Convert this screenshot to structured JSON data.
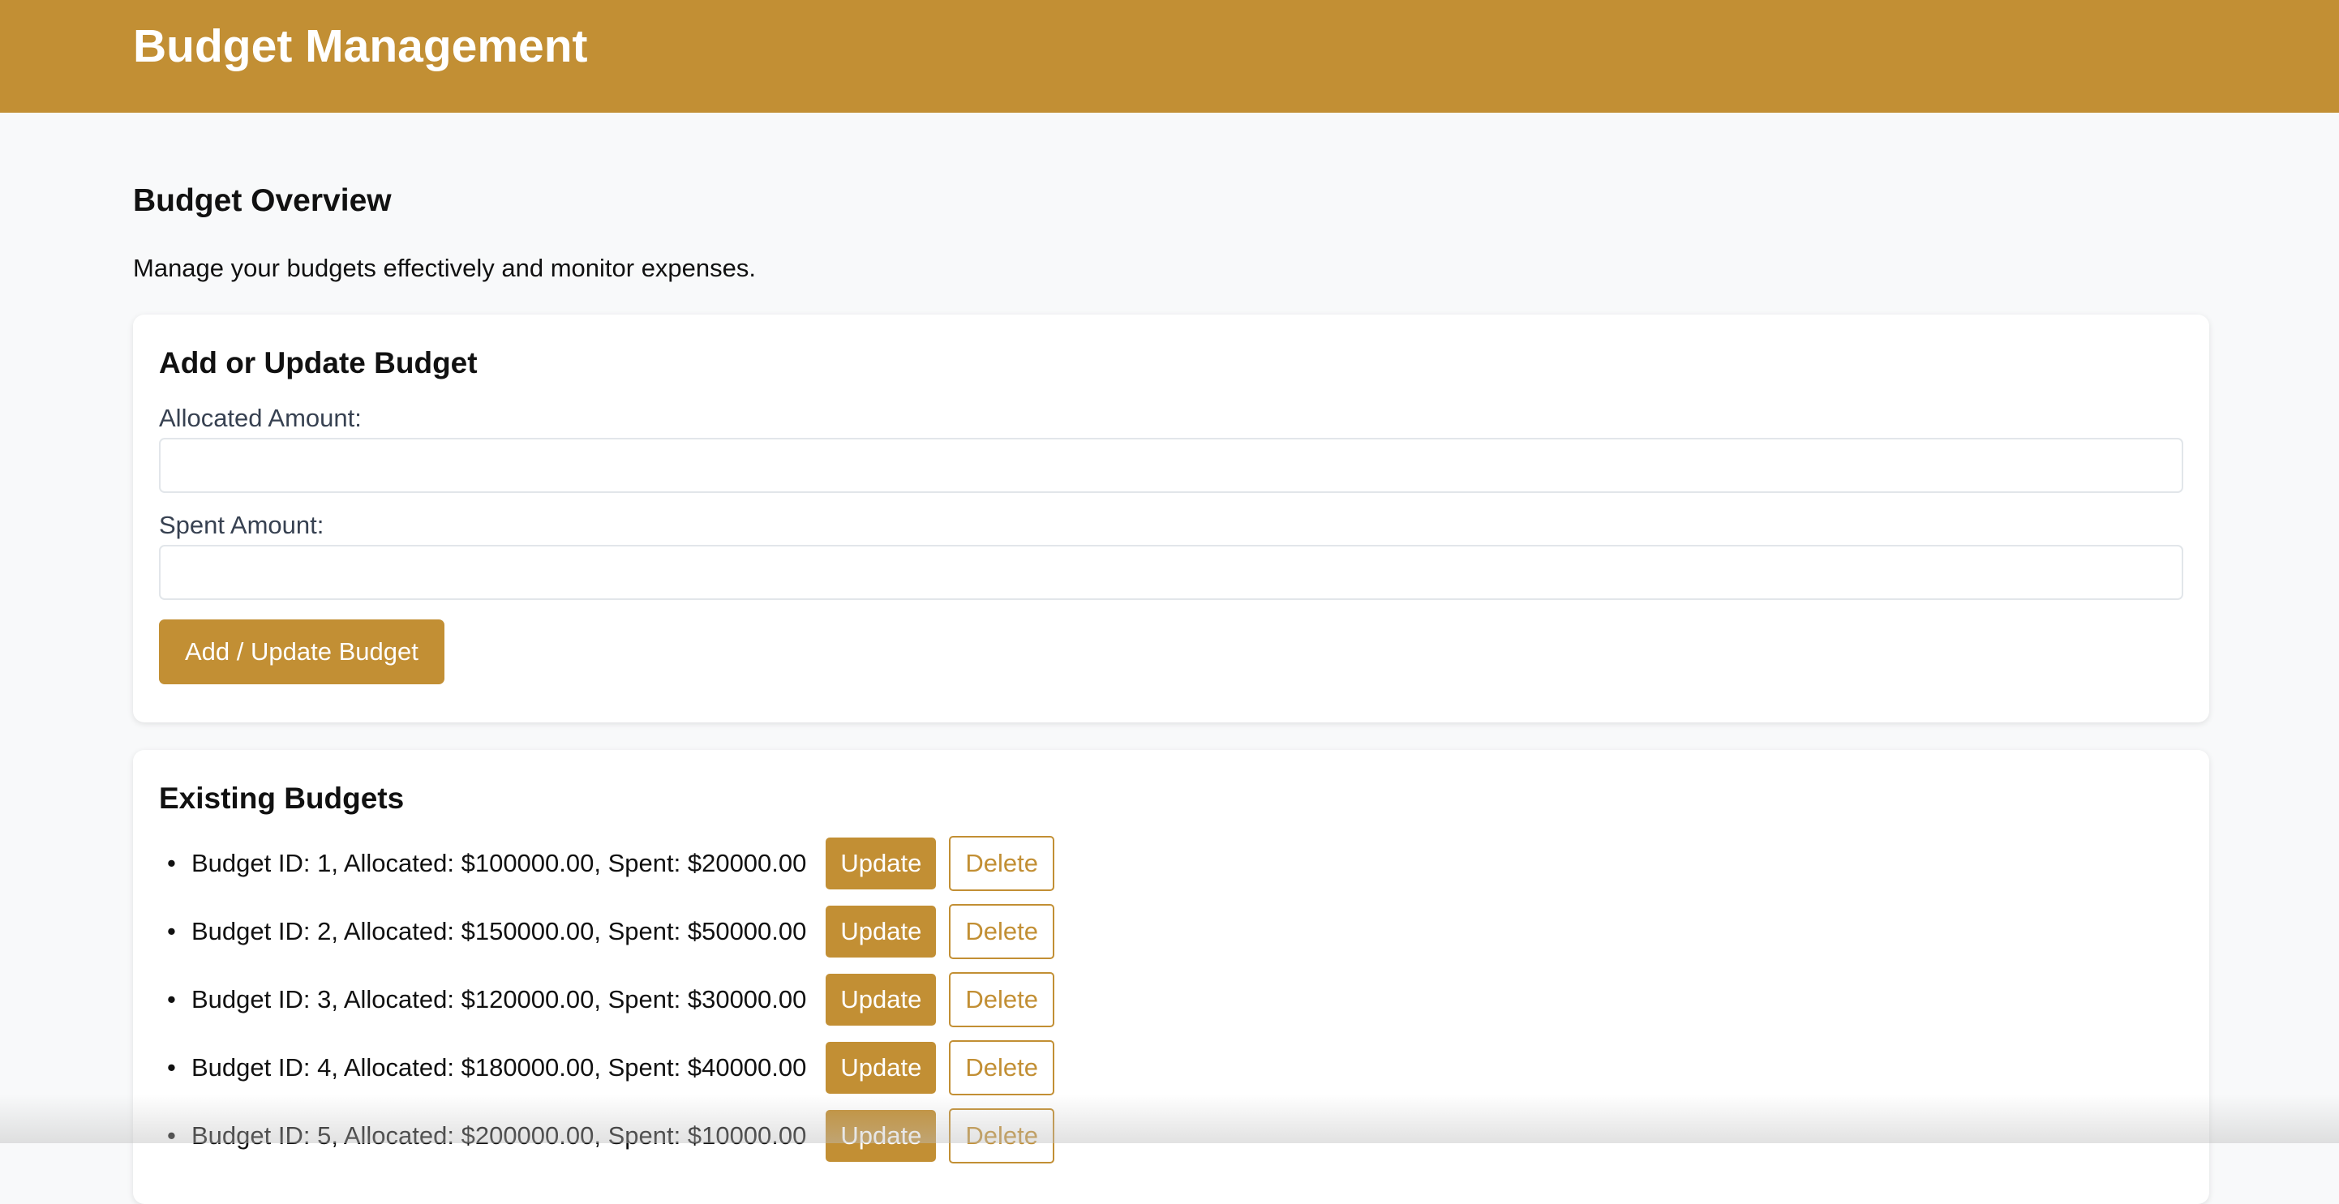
{
  "header": {
    "title": "Budget Management",
    "background_color": "#c28f34"
  },
  "overview": {
    "title": "Budget Overview",
    "description": "Manage your budgets effectively and monitor expenses."
  },
  "form": {
    "title": "Add or Update Budget",
    "allocated_label": "Allocated Amount:",
    "allocated_value": "",
    "allocated_placeholder": "",
    "spent_label": "Spent Amount:",
    "spent_value": "",
    "spent_placeholder": "",
    "submit_label": "Add / Update Budget"
  },
  "budgets": {
    "title": "Existing Budgets",
    "bullet": "•",
    "items": [
      {
        "text": "Budget ID: 1, Allocated: $100000.00, Spent: $20000.00",
        "update_label": "Update",
        "delete_label": "Delete"
      },
      {
        "text": "Budget ID: 2, Allocated: $150000.00, Spent: $50000.00",
        "update_label": "Update",
        "delete_label": "Delete"
      },
      {
        "text": "Budget ID: 3, Allocated: $120000.00, Spent: $30000.00",
        "update_label": "Update",
        "delete_label": "Delete"
      },
      {
        "text": "Budget ID: 4, Allocated: $180000.00, Spent: $40000.00",
        "update_label": "Update",
        "delete_label": "Delete"
      },
      {
        "text": "Budget ID: 5, Allocated: $200000.00, Spent: $10000.00",
        "update_label": "Update",
        "delete_label": "Delete"
      }
    ]
  },
  "colors": {
    "accent": "#c28f34",
    "page_background": "#f8f9fa",
    "card_background": "#ffffff"
  }
}
